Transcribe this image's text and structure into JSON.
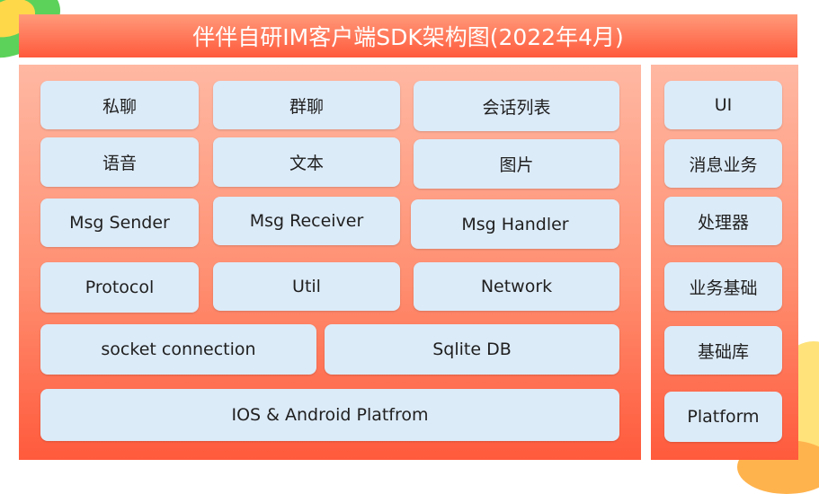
{
  "title": "伴伴自研IM客户端SDK架构图(2022年4月)",
  "main_blocks": [
    "私聊",
    "群聊",
    "会话列表",
    "语音",
    "文本",
    "图片",
    "Msg Sender",
    "Msg Receiver",
    "Msg Handler",
    "Protocol",
    "Util",
    "Network",
    "socket connection",
    "Sqlite DB",
    "IOS & Android Platfrom"
  ],
  "side_layers": [
    "UI",
    "消息业务",
    "处理器",
    "业务基础",
    "基础库",
    "Platform"
  ],
  "colors": {
    "panel_top": "#ffb8a3",
    "panel_bottom": "#ff5a3c",
    "box_fill": "#dcebf8",
    "title_text": "#ffffff"
  }
}
